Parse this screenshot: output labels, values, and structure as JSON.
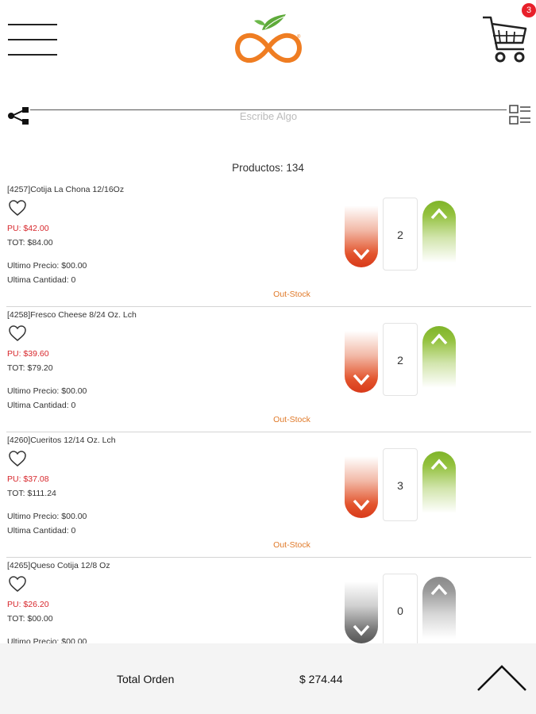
{
  "header": {
    "menu_icon": "hamburger-menu-icon",
    "logo_icon": "orange-infinity-logo",
    "cart_icon": "shopping-cart-icon",
    "cart_count": "3"
  },
  "search": {
    "placeholder": "Escribe Algo",
    "value": "",
    "share_icon": "share-nodes-icon",
    "view_icon": "list-view-toggle-icon"
  },
  "products_count_label": "Productos: 134",
  "colors": {
    "price_red": "#d7262b",
    "out_stock_orange": "#e07a2a",
    "decrement_red": "#d83a1a",
    "increment_green": "#7fb42a",
    "badge_red": "#e8202a"
  },
  "products": [
    {
      "code_name": "[4257]Cotija La Chona 12/16Oz",
      "unit_price": "PU: $42.00",
      "total": "TOT: $84.00",
      "last_price": "Ultimo Precio: $00.00",
      "last_qty": "Ultima Cantidad: 0",
      "stock": "Out-Stock",
      "quantity": "2"
    },
    {
      "code_name": "[4258]Fresco Cheese 8/24 Oz. Lch",
      "unit_price": "PU: $39.60",
      "total": "TOT: $79.20",
      "last_price": "Ultimo Precio: $00.00",
      "last_qty": "Ultima Cantidad: 0",
      "stock": "Out-Stock",
      "quantity": "2"
    },
    {
      "code_name": "[4260]Cueritos 12/14 Oz. Lch",
      "unit_price": "PU: $37.08",
      "total": "TOT: $111.24",
      "last_price": "Ultimo Precio: $00.00",
      "last_qty": "Ultima Cantidad: 0",
      "stock": "Out-Stock",
      "quantity": "3"
    },
    {
      "code_name": "[4265]Queso Cotija 12/8 Oz",
      "unit_price": "PU: $26.20",
      "total": "TOT: $00.00",
      "last_price": "Ultimo Precio: $00.00",
      "last_qty": "",
      "stock": "",
      "quantity": "0"
    }
  ],
  "footer": {
    "total_label": "Total Orden",
    "total_value": "$  274.44",
    "scroll_top_icon": "chevron-up-icon"
  }
}
